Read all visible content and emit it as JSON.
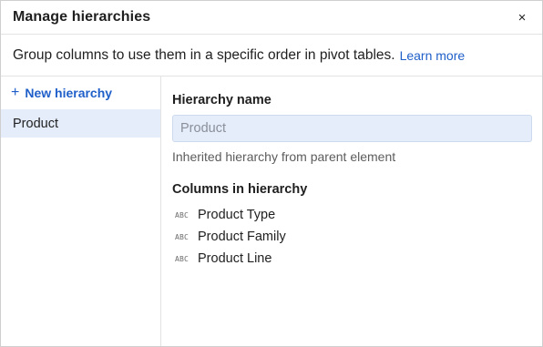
{
  "dialog": {
    "title": "Manage hierarchies",
    "close_icon": "×"
  },
  "description": {
    "text": "Group columns to use them in a specific order in pivot tables.",
    "link": "Learn more"
  },
  "sidebar": {
    "new_button_icon": "+",
    "new_button_label": "New hierarchy",
    "items": [
      {
        "label": "Product",
        "selected": true
      }
    ]
  },
  "details": {
    "name_label": "Hierarchy name",
    "name_placeholder": "Product",
    "hint": "Inherited hierarchy from parent element",
    "columns_label": "Columns in hierarchy",
    "columns": [
      {
        "type_icon": "ABC",
        "name": "Product Type"
      },
      {
        "type_icon": "ABC",
        "name": "Product Family"
      },
      {
        "type_icon": "ABC",
        "name": "Product Line"
      }
    ]
  },
  "colors": {
    "accent": "#1f5fc9",
    "selected_bg": "#e5edfb"
  }
}
